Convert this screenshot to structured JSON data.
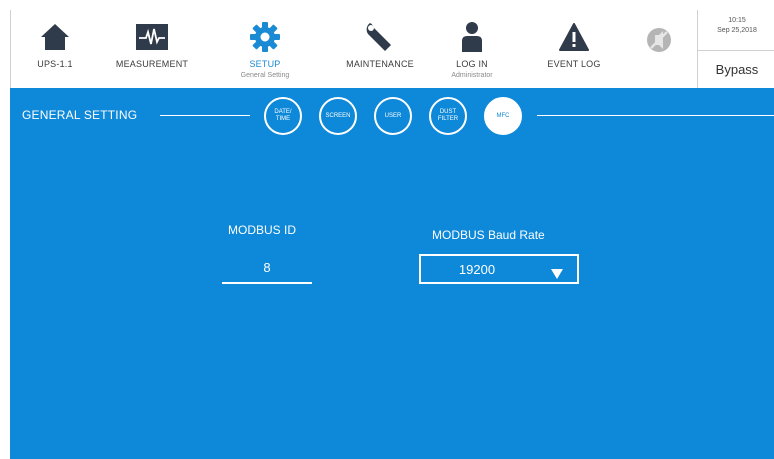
{
  "nav": {
    "items": [
      {
        "label": "UPS-1.1",
        "icon": "home-icon"
      },
      {
        "label": "MEASUREMENT",
        "icon": "waveform-icon"
      },
      {
        "label": "SETUP",
        "sublabel": "General Setting",
        "icon": "gear-icon",
        "active": true
      },
      {
        "label": "MAINTENANCE",
        "icon": "wrench-icon"
      },
      {
        "label": "LOG IN",
        "sublabel": "Administrator",
        "icon": "user-icon"
      },
      {
        "label": "EVENT LOG",
        "icon": "warning-icon"
      }
    ],
    "mute_icon": "mute-disabled-icon"
  },
  "status": {
    "time": "10:15",
    "date": "Sep 25,2018",
    "mode": "Bypass"
  },
  "main": {
    "section_title": "GENERAL SETTING",
    "tabs": [
      {
        "label": "DATE/\nTIME"
      },
      {
        "label": "SCREEN"
      },
      {
        "label": "USER"
      },
      {
        "label": "DUST\nFILTER"
      },
      {
        "label": "MFC",
        "active": true
      }
    ],
    "modbus_id": {
      "label": "MODBUS ID",
      "value": "8"
    },
    "baud_rate": {
      "label": "MODBUS Baud Rate",
      "value": "19200"
    }
  },
  "colors": {
    "accent": "#0e88d8",
    "active_nav_text": "#1a8ad4",
    "icon_dark": "#2f3a4a"
  }
}
